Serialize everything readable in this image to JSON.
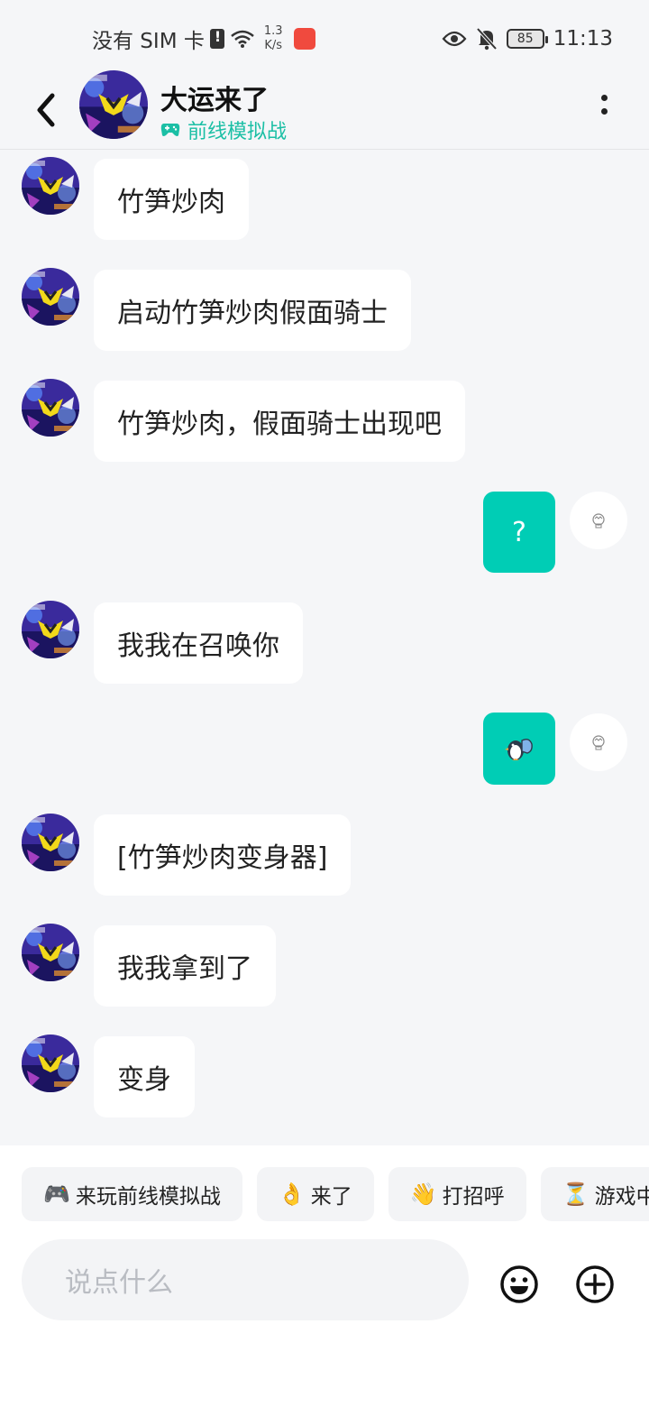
{
  "status_bar": {
    "carrier": "没有 SIM 卡",
    "speed_value": "1.3",
    "speed_unit": "K/s",
    "battery": "85",
    "time": "11:13"
  },
  "header": {
    "name": "大运来了",
    "subtitle": "前线模拟战"
  },
  "messages": [
    {
      "from": "other",
      "text": "竹笋炒肉"
    },
    {
      "from": "other",
      "text": "启动竹笋炒肉假面骑士"
    },
    {
      "from": "other",
      "text": "竹笋炒肉，假面骑士出现吧"
    },
    {
      "from": "me",
      "text": "?"
    },
    {
      "from": "other",
      "text": "我我在召唤你"
    },
    {
      "from": "me",
      "sticker": "penguin-wave-sticker"
    },
    {
      "from": "other",
      "text": "[竹笋炒肉变身器]"
    },
    {
      "from": "other",
      "text": "我我拿到了"
    },
    {
      "from": "other",
      "text": "变身"
    }
  ],
  "quick_replies": [
    {
      "emoji": "🎮",
      "label": "来玩前线模拟战"
    },
    {
      "emoji": "👌",
      "label": "来了"
    },
    {
      "emoji": "👋",
      "label": "打招呼"
    },
    {
      "emoji": "⏳",
      "label": "游戏中"
    }
  ],
  "input": {
    "placeholder": "说点什么"
  },
  "colors": {
    "accent": "#00cdb5",
    "subtitle": "#1bbfa5",
    "background": "#f5f6f8"
  }
}
